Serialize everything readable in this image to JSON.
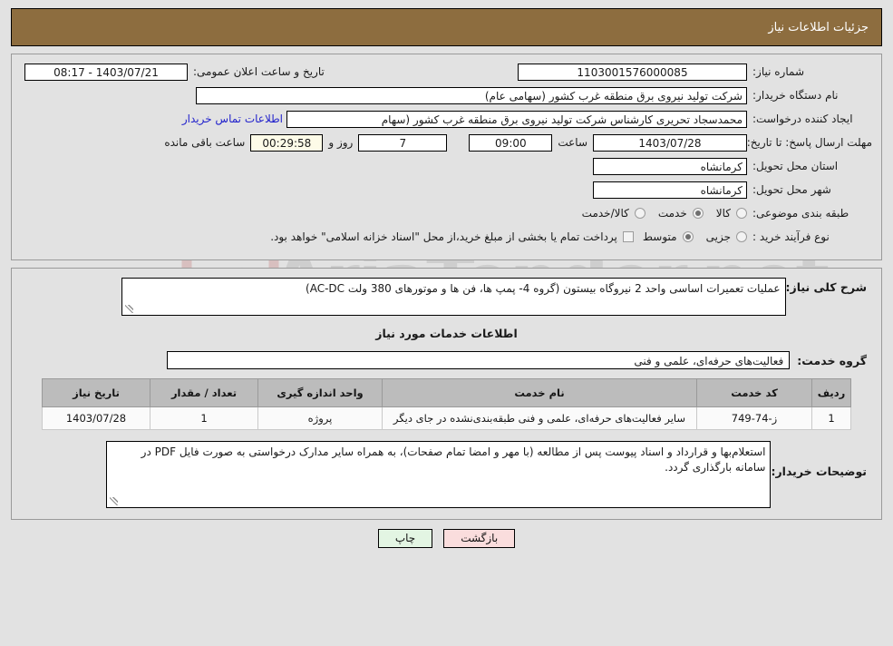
{
  "header": {
    "title": "جزئیات اطلاعات نیاز"
  },
  "watermark": {
    "text": "AriaTender.net"
  },
  "top_form": {
    "need_number_label": "شماره نیاز:",
    "need_number_value": "1103001576000085",
    "announce_label": "تاریخ و ساعت اعلان عمومی:",
    "announce_value": "1403/07/21 - 08:17",
    "buyer_org_label": "نام دستگاه خریدار:",
    "buyer_org_value": "شرکت تولید نیروی برق منطقه غرب کشور (سهامی عام)",
    "creator_label": "ایجاد کننده درخواست:",
    "creator_value": "محمدسجاد تحریری کارشناس شرکت تولید نیروی برق منطقه غرب کشور (سهام",
    "contact_link": "اطلاعات تماس خریدار",
    "deadline_label": "مهلت ارسال پاسخ: تا تاریخ:",
    "deadline_date": "1403/07/28",
    "hour_label": "ساعت",
    "deadline_time": "09:00",
    "days_remaining": "7",
    "days_label": "روز و",
    "timer_value": "00:29:58",
    "timer_label": "ساعت باقی مانده",
    "province_label": "استان محل تحویل:",
    "province_value": "کرمانشاه",
    "city_label": "شهر محل تحویل:",
    "city_value": "کرمانشاه",
    "category_label": "طبقه بندی موضوعی:",
    "category_options": [
      {
        "label": "کالا",
        "selected": false
      },
      {
        "label": "خدمت",
        "selected": true
      },
      {
        "label": "کالا/خدمت",
        "selected": false
      }
    ],
    "process_label": "نوع فرآیند خرید :",
    "process_options": [
      {
        "label": "جزیی",
        "selected": false
      },
      {
        "label": "متوسط",
        "selected": true
      }
    ],
    "treasury_checkbox_checked": false,
    "treasury_note": "پرداخت تمام یا بخشی از مبلغ خرید،از محل \"اسناد خزانه اسلامی\" خواهد بود."
  },
  "description": {
    "label": "شرح کلی نیاز:",
    "value": "عملیات تعمیرات اساسی واحد 2 نیروگاه بیستون (گروه 4- پمپ ها، فن ها و موتورهای 380 ولت  AC-DC)"
  },
  "services_section": {
    "title": "اطلاعات خدمات مورد نیاز",
    "group_label": "گروه خدمت:",
    "group_value": "فعالیت‌های حرفه‌ای، علمی و فنی"
  },
  "table": {
    "headers": [
      "ردیف",
      "کد خدمت",
      "نام خدمت",
      "واحد اندازه گیری",
      "تعداد / مقدار",
      "تاریخ نیاز"
    ],
    "rows": [
      {
        "radif": "1",
        "code": "ز-74-749",
        "name": "سایر فعالیت‌های حرفه‌ای، علمی و فنی طبقه‌بندی‌نشده در جای دیگر",
        "unit": "پروژه",
        "qty": "1",
        "date": "1403/07/28"
      }
    ]
  },
  "buyer_notes": {
    "label": "توضیحات خریدار:",
    "value": "استعلام‌بها و قرارداد و اسناد پیوست پس از مطالعه (با مهر و امضا تمام صفحات)، به همراه سایر مدارک درخواستی به صورت فایل PDF در سامانه بارگذاری گردد."
  },
  "footer": {
    "print_label": "چاپ",
    "back_label": "بازگشت"
  },
  "colors": {
    "header_bar": "#8d6d3f",
    "page_background": "#e2e2e2",
    "link": "#2222cc",
    "timer_field": "#fdfbe8",
    "table_header": "#bcbcbc",
    "print_button": "#e3f5e3",
    "back_button": "#fadddd"
  }
}
